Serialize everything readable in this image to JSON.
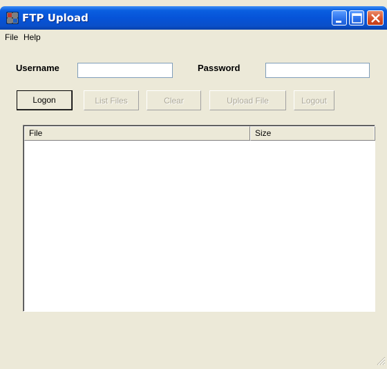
{
  "window": {
    "title": "FTP Upload",
    "title_bar_color": "#0653d8"
  },
  "menu": {
    "items": [
      {
        "label": "File"
      },
      {
        "label": "Help"
      }
    ]
  },
  "form": {
    "username_label": "Username",
    "username_value": "",
    "password_label": "Password",
    "password_value": ""
  },
  "toolbar": {
    "buttons": [
      {
        "label": "Logon",
        "enabled": true
      },
      {
        "label": "List Files",
        "enabled": false
      },
      {
        "label": "Clear",
        "enabled": false
      },
      {
        "label": "Upload File",
        "enabled": false
      },
      {
        "label": "Logout",
        "enabled": false
      }
    ]
  },
  "file_list": {
    "columns": [
      "File",
      "Size"
    ],
    "rows": []
  },
  "icons": {
    "app": "ftp-app-icon",
    "minimize": "minimize-icon",
    "maximize": "maximize-icon",
    "close": "close-icon",
    "resize": "resize-grip-icon"
  }
}
